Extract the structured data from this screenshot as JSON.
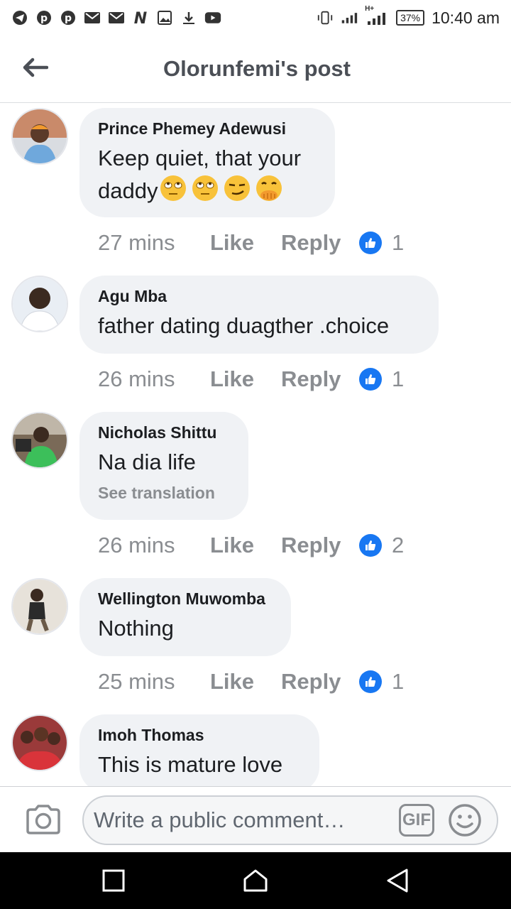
{
  "status_bar": {
    "left_icons": [
      "telegram-icon",
      "pinterest-icon",
      "pinterest-icon",
      "gmail-icon",
      "gmail-icon",
      "n-app-icon",
      "gallery-icon",
      "download-icon",
      "youtube-icon"
    ],
    "network_type": "H+",
    "battery": "37%",
    "time": "10:40 am"
  },
  "header": {
    "title": "Olorunfemi's post",
    "back_icon": "back-arrow-icon"
  },
  "comments": [
    {
      "author": "Prince Phemey Adewusi",
      "text_line1": "Keep quiet, that your",
      "text_line2": "daddy",
      "emojis": [
        "face-with-rolling-eyes",
        "face-with-rolling-eyes",
        "smirking-face",
        "face-with-hand-over-mouth"
      ],
      "time": "27 mins",
      "like_label": "Like",
      "reply_label": "Reply",
      "reaction_count": "1"
    },
    {
      "author": "Agu Mba",
      "text": "father dating duagther .choice",
      "time": "26 mins",
      "like_label": "Like",
      "reply_label": "Reply",
      "reaction_count": "1"
    },
    {
      "author": "Nicholas Shittu",
      "text": "Na dia life",
      "see_translation": "See translation",
      "time": "26 mins",
      "like_label": "Like",
      "reply_label": "Reply",
      "reaction_count": "2"
    },
    {
      "author": "Wellington Muwomba",
      "text": "Nothing",
      "time": "25 mins",
      "like_label": "Like",
      "reply_label": "Reply",
      "reaction_count": "1"
    },
    {
      "author": "Imoh Thomas",
      "text": "This is mature love"
    }
  ],
  "composer": {
    "placeholder": "Write a public comment…",
    "gif_label": "GIF",
    "camera_icon": "camera-icon",
    "emoji_icon": "smiley-icon"
  },
  "colors": {
    "like_badge": "#1877f2",
    "bubble": "#f0f2f5",
    "meta_text": "#8a8d91",
    "title": "#4b4f56"
  }
}
